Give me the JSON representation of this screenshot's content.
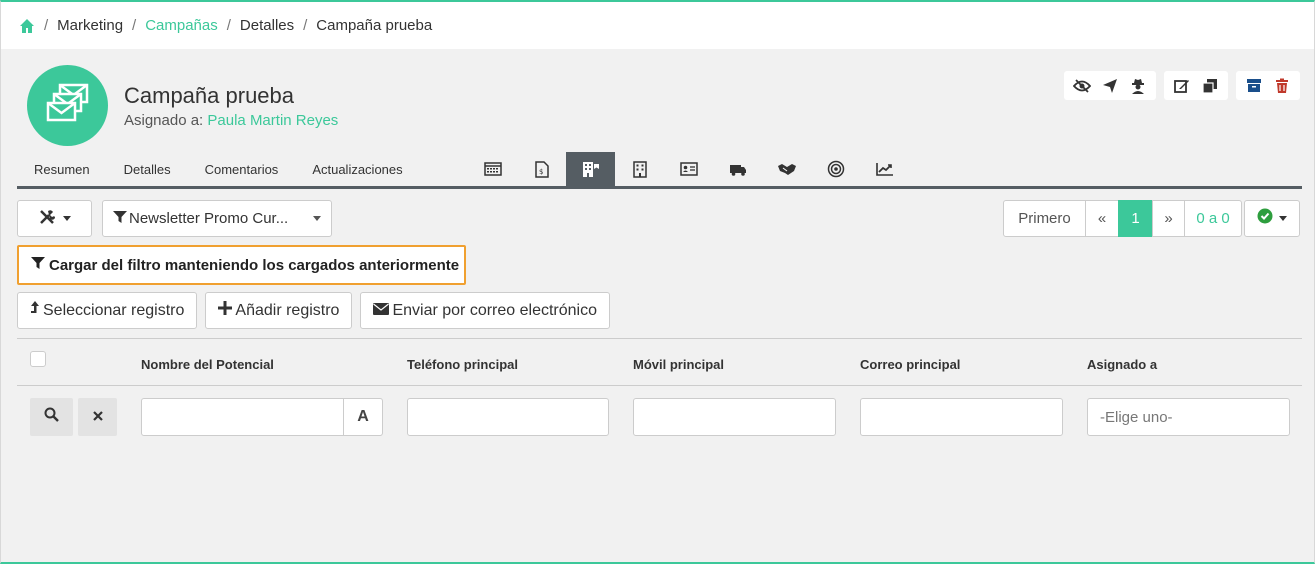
{
  "breadcrumb": {
    "items": [
      {
        "label": "Marketing",
        "link": false
      },
      {
        "label": "Campañas",
        "link": true
      },
      {
        "label": "Detalles",
        "link": false
      },
      {
        "label": "Campaña prueba",
        "link": false
      }
    ],
    "separator": "/"
  },
  "header": {
    "title": "Campaña prueba",
    "assigned_label": "Asignado a:",
    "assigned_user": "Paula Martin Reyes"
  },
  "tabs": [
    {
      "label": "Resumen"
    },
    {
      "label": "Detalles"
    },
    {
      "label": "Comentarios"
    },
    {
      "label": "Actualizaciones"
    }
  ],
  "icon_tabs": [
    "calendar-icon",
    "document-icon",
    "building-active-icon",
    "building-icon",
    "contact-card-icon",
    "truck-icon",
    "handshake-icon",
    "target-icon",
    "chart-line-icon"
  ],
  "toolbar": {
    "filter_label": "Newsletter Promo Cur..."
  },
  "pager": {
    "first": "Primero",
    "prev": "«",
    "current": "1",
    "next": "»",
    "count": "0 a 0"
  },
  "filter_load_label": "Cargar del filtro manteniendo los cargados anteriormente",
  "record_actions": {
    "select": "Seleccionar registro",
    "add": "Añadir registro",
    "email": "Enviar por correo electrónico"
  },
  "table": {
    "columns": [
      "Nombre del Potencial",
      "Teléfono principal",
      "Móvil principal",
      "Correo principal",
      "Asignado a"
    ]
  },
  "filters": {
    "assigned_placeholder": "-Elige uno-",
    "text_mode": "A"
  },
  "colors": {
    "accent": "#3cc89a",
    "highlight_border": "#f0a030",
    "delete": "#c0392b",
    "archive": "#1a4f8b"
  }
}
